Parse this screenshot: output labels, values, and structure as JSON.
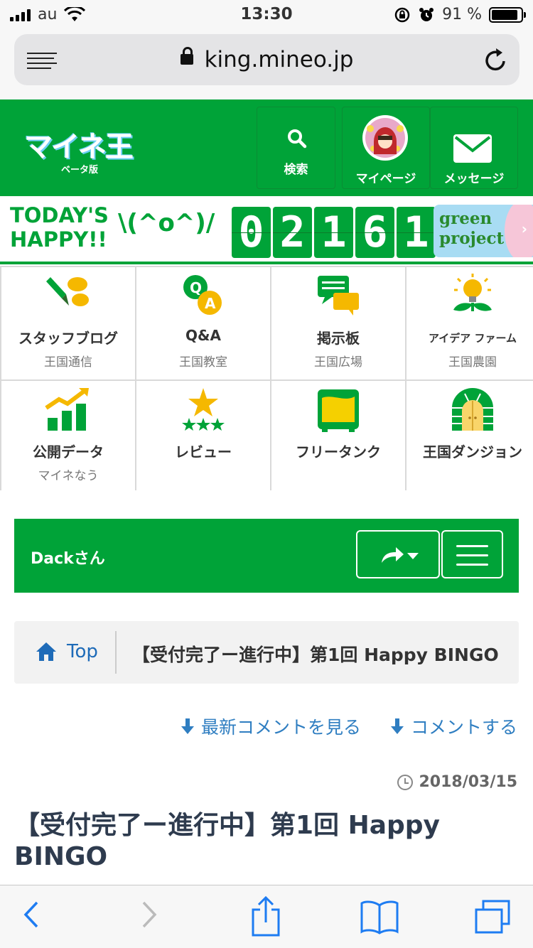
{
  "status_bar": {
    "carrier": "au",
    "time": "13:30",
    "battery_percent": "91 %",
    "battery_level": 0.91
  },
  "browser": {
    "url": "king.mineo.jp"
  },
  "header": {
    "logo_text": "マイネ王",
    "logo_beta": "ベータ版",
    "search_label": "検索",
    "mypage_label": "マイページ",
    "message_label": "メッセージ",
    "colors": {
      "brand_green": "#00a338"
    }
  },
  "happy_banner": {
    "line1": "TODAY'S",
    "line2": "HAPPY!!",
    "face": "\\(^o^)/",
    "digits": [
      "0",
      "2",
      "1",
      "6",
      "1"
    ],
    "green_project_line1": "green",
    "green_project_line2": "project",
    "arrow": "›"
  },
  "nav": {
    "items": [
      {
        "title": "スタッフブログ",
        "sub": "王国通信",
        "icon": "pen-chat-icon"
      },
      {
        "title": "Q&A",
        "sub": "王国教室",
        "icon": "qa-bubbles-icon"
      },
      {
        "title": "掲示板",
        "sub": "王国広場",
        "icon": "board-chat-icon"
      },
      {
        "title": "アイデア ファーム",
        "sub": "王国農園",
        "icon": "lightbulb-sprout-icon"
      },
      {
        "title": "公開データ",
        "sub": "マイネなう",
        "icon": "bar-chart-icon"
      },
      {
        "title": "レビュー",
        "sub": "",
        "icon": "stars-icon"
      },
      {
        "title": "フリータンク",
        "sub": "",
        "icon": "tank-icon"
      },
      {
        "title": "王国ダンジョン",
        "sub": "",
        "icon": "dungeon-door-icon"
      }
    ]
  },
  "user_bar": {
    "user_name": "Dackさん"
  },
  "breadcrumb": {
    "home_label": "Top",
    "current": "【受付完了ー進行中】第1回 Happy BINGO"
  },
  "comment_links": {
    "latest": "最新コメントを見る",
    "comment": "コメントする"
  },
  "post": {
    "date": "2018/03/15",
    "title": "【受付完了ー進行中】第1回 Happy BINGO"
  }
}
